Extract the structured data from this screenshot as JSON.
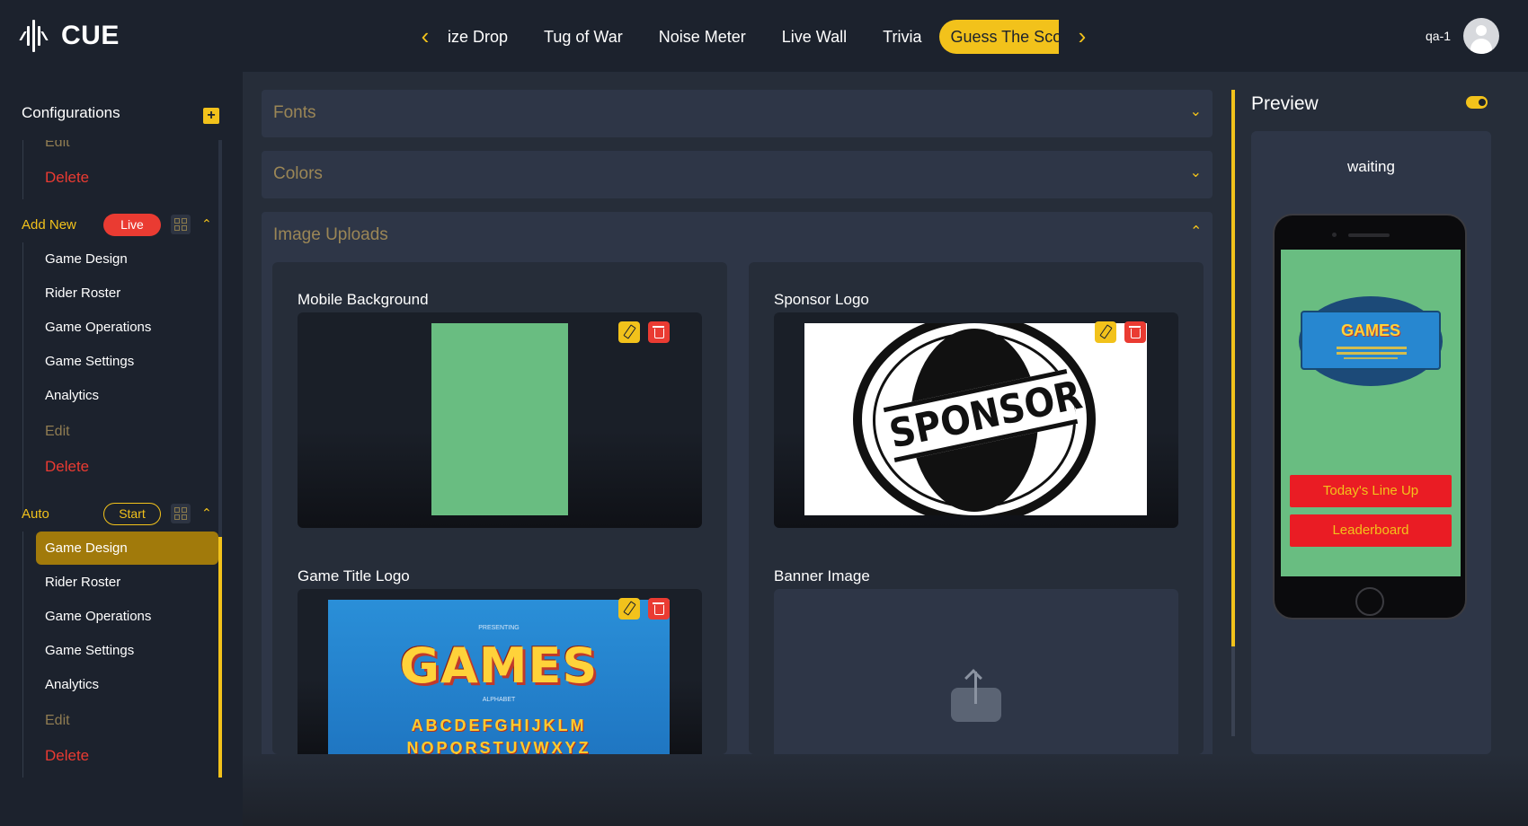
{
  "app": {
    "logo_text": "CUE",
    "user": "qa-1"
  },
  "nav": {
    "tabs": [
      {
        "label": "ize Drop"
      },
      {
        "label": "Tug of War"
      },
      {
        "label": "Noise Meter"
      },
      {
        "label": "Live Wall"
      },
      {
        "label": "Trivia"
      },
      {
        "label": "Guess The Score"
      }
    ],
    "active_tab": "Guess The Score"
  },
  "sidebar": {
    "title": "Configurations",
    "top_items": [
      {
        "label": "Edit"
      },
      {
        "label": "Delete"
      }
    ],
    "groups": [
      {
        "name": "Add New",
        "status": "Live",
        "items": [
          {
            "label": "Game Design"
          },
          {
            "label": "Rider Roster"
          },
          {
            "label": "Game Operations"
          },
          {
            "label": "Game Settings"
          },
          {
            "label": "Analytics"
          },
          {
            "label": "Edit"
          },
          {
            "label": "Delete"
          }
        ]
      },
      {
        "name": "Auto",
        "status": "Start",
        "items": [
          {
            "label": "Game Design"
          },
          {
            "label": "Rider Roster"
          },
          {
            "label": "Game Operations"
          },
          {
            "label": "Game Settings"
          },
          {
            "label": "Analytics"
          },
          {
            "label": "Edit"
          },
          {
            "label": "Delete"
          }
        ],
        "active_item": "Game Design"
      }
    ]
  },
  "main": {
    "sections": [
      {
        "title": "Fonts",
        "expanded": false
      },
      {
        "title": "Colors",
        "expanded": false
      },
      {
        "title": "Image Uploads",
        "expanded": true
      }
    ],
    "uploads": [
      {
        "label": "Mobile Background",
        "has_image": true
      },
      {
        "label": "Sponsor Logo",
        "has_image": true,
        "image_text": "SPONSOR"
      },
      {
        "label": "Game Title Logo",
        "has_image": true,
        "image_text": "GAMES",
        "image_caption_top": "PRESENTING",
        "image_caption_mid": "ALPHABET",
        "image_letters_1": "ABCDEFGHIJKLM",
        "image_letters_2": "NOPQRSTUVWXYZ"
      },
      {
        "label": "Banner Image",
        "has_image": false
      }
    ]
  },
  "preview": {
    "title": "Preview",
    "toggle_on": true,
    "status": "waiting",
    "phone": {
      "screen_color": "#69bd81",
      "logo_text": "GAMES",
      "buttons": [
        {
          "label": "Today's Line Up"
        },
        {
          "label": "Leaderboard"
        }
      ]
    }
  },
  "colors": {
    "accent": "#f2c21b",
    "danger": "#ea3b32",
    "bg": "#1c222d",
    "panel": "#2e3647"
  }
}
